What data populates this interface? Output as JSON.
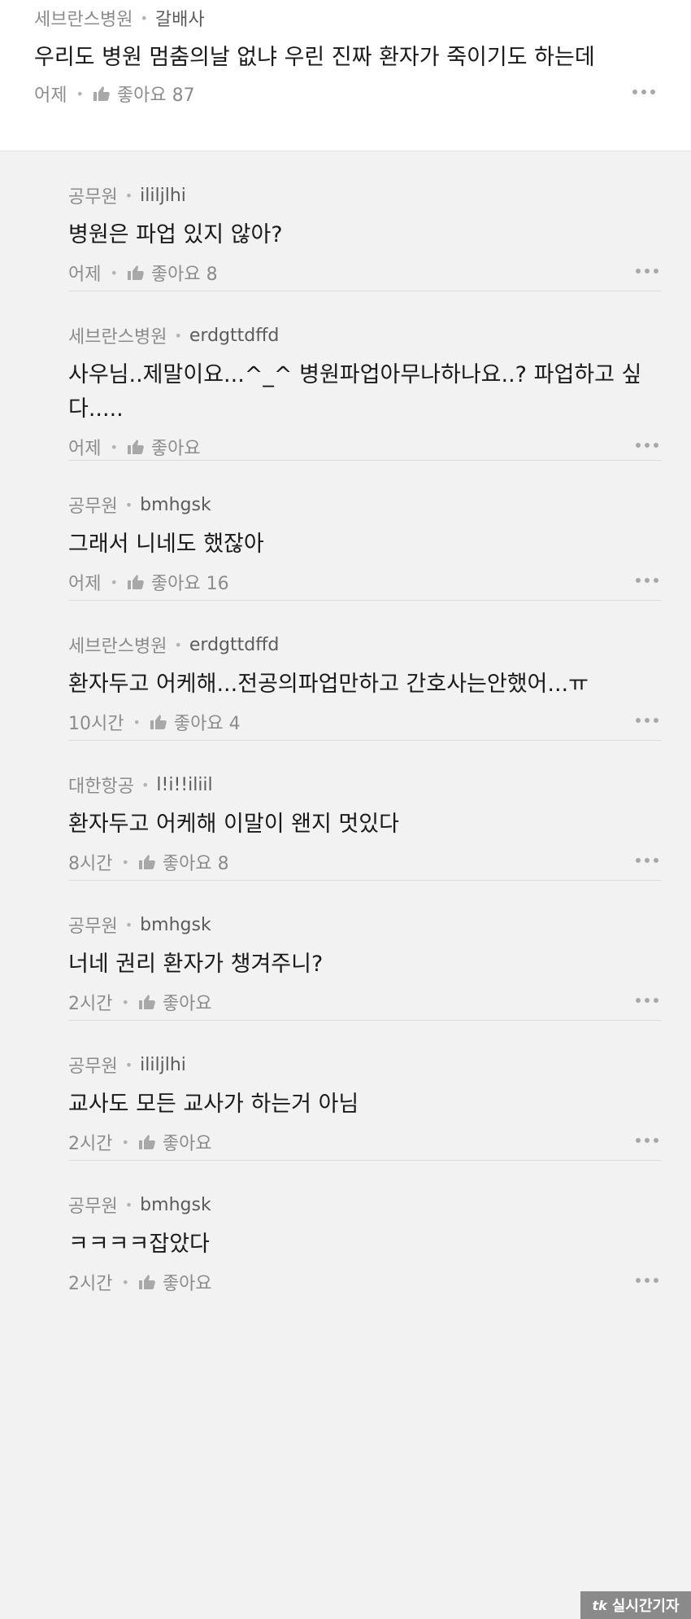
{
  "top_comment": {
    "company": "세브란스병원",
    "nick": "갈배사",
    "text": "우리도 병원 멈춤의날 없냐 우린 진짜 환자가 죽이기도 하는데",
    "time": "어제",
    "likes": "좋아요 87"
  },
  "replies": [
    {
      "company": "공무원",
      "nick": "ililjlhi",
      "text": "병원은 파업 있지 않아?",
      "time": "어제",
      "likes": "좋아요 8"
    },
    {
      "company": "세브란스병원",
      "nick": "erdgttdffd",
      "text": "사우님..제말이요...^_^ 병원파업아무나하나요..? 파업하고 싶다.....",
      "time": "어제",
      "likes": "좋아요"
    },
    {
      "company": "공무원",
      "nick": "bmhgsk",
      "text": "그래서 니네도 했잖아",
      "time": "어제",
      "likes": "좋아요 16"
    },
    {
      "company": "세브란스병원",
      "nick": "erdgttdffd",
      "text": "환자두고 어케해...전공의파업만하고 간호사는안했어...ㅠ",
      "time": "10시간",
      "likes": "좋아요 4"
    },
    {
      "company": "대한항공",
      "nick": "l!i!!iliil",
      "text": "환자두고 어케해 이말이 왠지 멋있다",
      "time": "8시간",
      "likes": "좋아요 8"
    },
    {
      "company": "공무원",
      "nick": "bmhgsk",
      "text": "너네 권리 환자가 챙겨주니?",
      "time": "2시간",
      "likes": "좋아요"
    },
    {
      "company": "공무원",
      "nick": "ililjlhi",
      "text": "교사도 모든 교사가 하는거 아님",
      "time": "2시간",
      "likes": "좋아요"
    },
    {
      "company": "공무원",
      "nick": "bmhgsk",
      "text": "ㅋㅋㅋㅋ잡았다",
      "time": "2시간",
      "likes": "좋아요"
    }
  ],
  "watermark": {
    "logo": "tk",
    "text": "실시간기자"
  },
  "icons": {
    "like": "thumbs-up-icon",
    "more": "more-dots-icon"
  },
  "colors": {
    "background": "#f2f2f2",
    "card": "#ffffff",
    "meta": "#8c8c8c"
  }
}
